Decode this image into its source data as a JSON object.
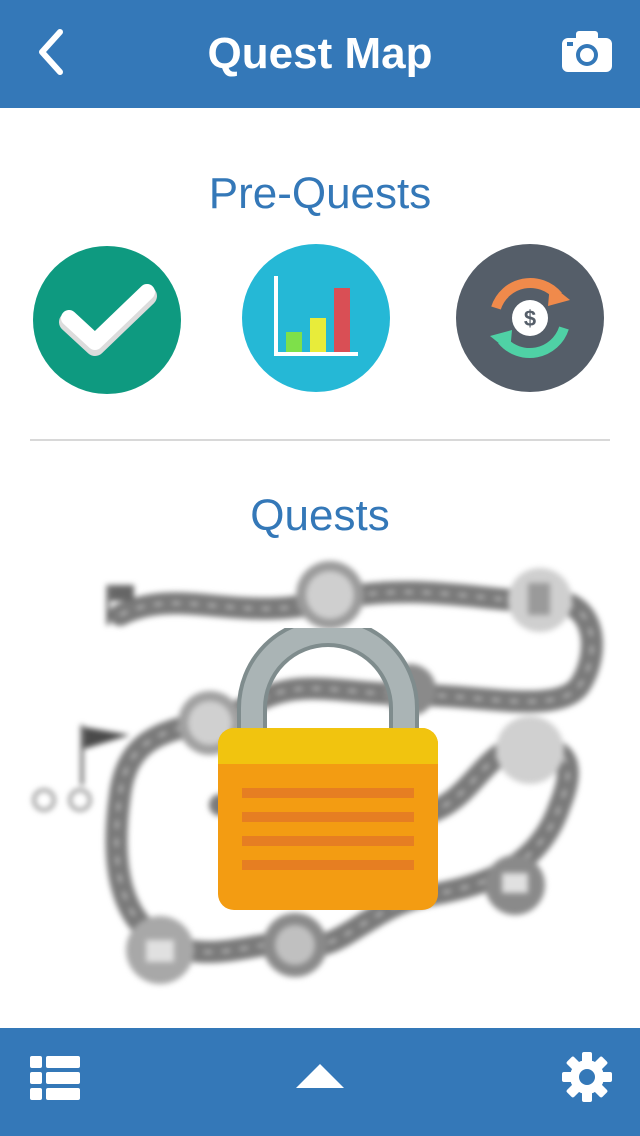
{
  "header": {
    "title": "Quest Map",
    "back_icon": "chevron-left-icon",
    "camera_icon": "camera-icon"
  },
  "pre_quests": {
    "title": "Pre-Quests",
    "items": [
      {
        "icon": "checkmark-icon",
        "color": "#0e9a80",
        "status": "completed"
      },
      {
        "icon": "bar-chart-icon",
        "color": "#25b8d6"
      },
      {
        "icon": "money-exchange-icon",
        "color": "#555e69"
      }
    ]
  },
  "quests": {
    "title": "Quests",
    "map_state": "locked",
    "lock_icon": "padlock-icon"
  },
  "footer": {
    "list_icon": "list-icon",
    "up_icon": "caret-up-icon",
    "settings_icon": "gear-icon"
  },
  "colors": {
    "brand_blue": "#3478b8",
    "lock_body": "#f39c12",
    "lock_shackle": "#95a5a6"
  }
}
